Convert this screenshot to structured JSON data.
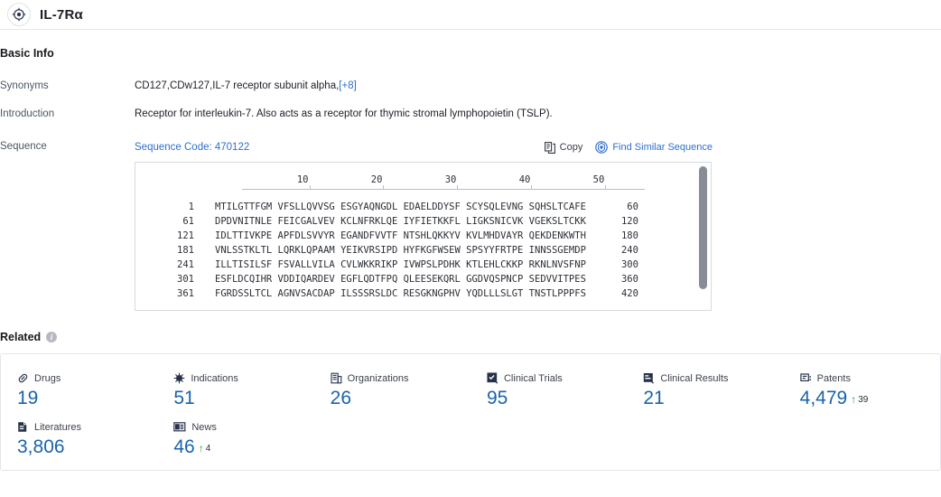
{
  "header": {
    "icon": "target-icon",
    "title": "IL-7Rα"
  },
  "basic_info": {
    "section_title": "Basic Info",
    "rows": {
      "synonyms_label": "Synonyms",
      "synonyms_value": "CD127,CDw127,IL-7 receptor subunit alpha,",
      "synonyms_more": "[+8]",
      "introduction_label": "Introduction",
      "introduction_value": "Receptor for interleukin-7. Also acts as a receptor for thymic stromal lymphopoietin (TSLP).",
      "sequence_label": "Sequence"
    }
  },
  "sequence": {
    "code_text": "Sequence Code: 470122",
    "copy_label": "Copy",
    "copy_icon": "copy-icon",
    "find_similar_label": "Find Similar Sequence",
    "find_similar_icon": "find-similar-icon",
    "ruler_ticks": [
      10,
      20,
      30,
      40,
      50
    ],
    "rows": [
      {
        "start": "1",
        "blocks": "MTILGTTFGM VFSLLQVVSG ESGYAQNGDL EDAELDDYSF SCYSQLEVNG SQHSLTCAFE",
        "end": "60"
      },
      {
        "start": "61",
        "blocks": "DPDVNITNLE FEICGALVEV KCLNFRKLQE IYFIETKKFL LIGKSNICVK VGEKSLTCKK",
        "end": "120"
      },
      {
        "start": "121",
        "blocks": "IDLTTIVKPE APFDLSVVYR EGANDFVVTF NTSHLQKKYV KVLMHDVAYR QEKDENKWTH",
        "end": "180"
      },
      {
        "start": "181",
        "blocks": "VNLSSTKLTL LQRKLQPAAM YEIKVRSIPD HYFKGFWSEW SPSYYFRTPE INNSSGEMDP",
        "end": "240"
      },
      {
        "start": "241",
        "blocks": "ILLTISILSF FSVALLVILA CVLWKKRIKP IVWPSLPDHK KTLEHLCKKP RKNLNVSFNP",
        "end": "300"
      },
      {
        "start": "301",
        "blocks": "ESFLDCQIHR VDDIQARDEV EGFLQDTFPQ QLEESEKQRL GGDVQSPNCP SEDVVITPES",
        "end": "360"
      },
      {
        "start": "361",
        "blocks": "FGRDSSLTCL AGNVSACDAP ILSSSRSLDC RESGKNGPHV YQDLLLSLGT TNSTLPPPFS",
        "end": "420"
      }
    ]
  },
  "related": {
    "section_title": "Related",
    "info_icon": "info-icon",
    "stats": [
      {
        "label": "Drugs",
        "icon": "drug-capsule-icon",
        "value": "19",
        "delta": null
      },
      {
        "label": "Indications",
        "icon": "virus-icon",
        "value": "51",
        "delta": null
      },
      {
        "label": "Organizations",
        "icon": "building-icon",
        "value": "26",
        "delta": null
      },
      {
        "label": "Clinical Trials",
        "icon": "clinical-trial-icon",
        "value": "95",
        "delta": null
      },
      {
        "label": "Clinical Results",
        "icon": "clinical-result-icon",
        "value": "21",
        "delta": null
      },
      {
        "label": "Patents",
        "icon": "patent-icon",
        "value": "4,479",
        "delta": "39"
      },
      {
        "label": "Literatures",
        "icon": "literature-icon",
        "value": "3,806",
        "delta": null
      },
      {
        "label": "News",
        "icon": "news-icon",
        "value": "46",
        "delta": "4"
      }
    ]
  },
  "colors": {
    "accent_blue": "#2f6fd0",
    "value_blue": "#1963ab",
    "delta_green": "#21a24a",
    "text_dark": "#16181c",
    "label_gray": "#4c5564",
    "border": "#e3e5e8"
  }
}
